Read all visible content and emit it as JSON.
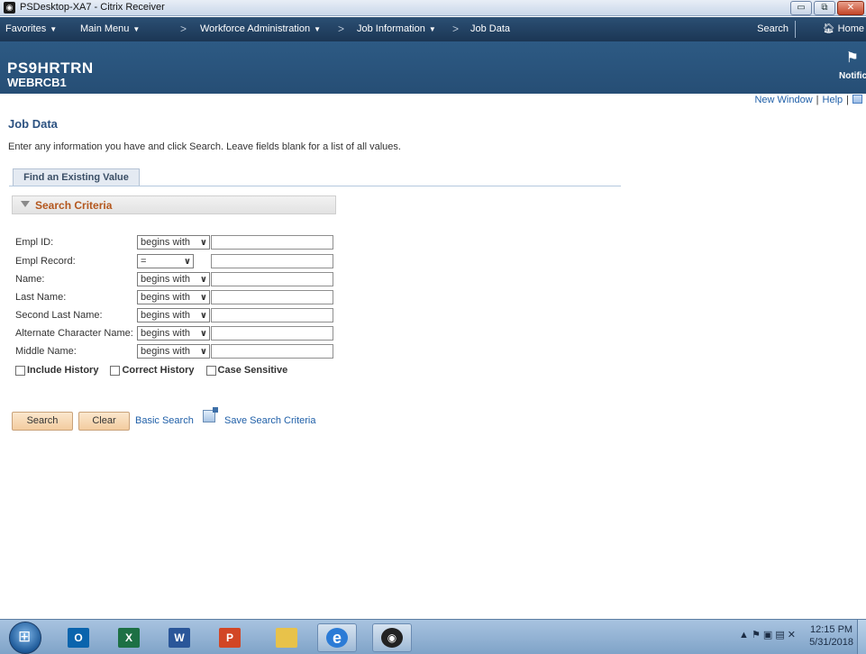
{
  "window": {
    "title": "PSDesktop-XA7 - Citrix Receiver",
    "minimize": "▭",
    "maximize": "⧉",
    "close": "✕"
  },
  "nav": {
    "favorites": "Favorites",
    "main_menu": "Main Menu",
    "breadcrumb_sep": ">",
    "workforce_admin": "Workforce Administration",
    "job_information": "Job Information",
    "job_data": "Job Data",
    "search": "Search",
    "home": "Home"
  },
  "banner": {
    "system": "PS9HRTRN",
    "database": "WEBRCB1",
    "notifications": "Notific"
  },
  "toplinks": {
    "new_window": "New Window",
    "help": "Help"
  },
  "page": {
    "title": "Job Data",
    "instructions": "Enter any information you have and click Search. Leave fields blank for a list of all values.",
    "tab_find": "Find an Existing Value",
    "section_title": "Search Criteria"
  },
  "fields": [
    {
      "label": "Empl ID:",
      "operator": "begins with",
      "value": ""
    },
    {
      "label": "Empl Record:",
      "operator": "=",
      "value": ""
    },
    {
      "label": "Name:",
      "operator": "begins with",
      "value": ""
    },
    {
      "label": "Last Name:",
      "operator": "begins with",
      "value": ""
    },
    {
      "label": "Second Last Name:",
      "operator": "begins with",
      "value": ""
    },
    {
      "label": "Alternate Character Name:",
      "operator": "begins with",
      "value": ""
    },
    {
      "label": "Middle Name:",
      "operator": "begins with",
      "value": ""
    }
  ],
  "checkboxes": {
    "include_history": "Include History",
    "correct_history": "Correct History",
    "case_sensitive": "Case Sensitive"
  },
  "actions": {
    "search": "Search",
    "clear": "Clear",
    "basic_search": "Basic Search",
    "save_search": "Save Search Criteria"
  },
  "taskbar": {
    "apps": [
      {
        "name": "outlook",
        "glyph": "O",
        "color": "#0a64ad"
      },
      {
        "name": "excel",
        "glyph": "X",
        "color": "#1d7044"
      },
      {
        "name": "word",
        "glyph": "W",
        "color": "#2a5699"
      },
      {
        "name": "powerpoint",
        "glyph": "P",
        "color": "#d24625"
      },
      {
        "name": "file-explorer",
        "glyph": "",
        "color": "#e8c24a"
      },
      {
        "name": "internet-explorer",
        "glyph": "e",
        "color": "#2b7bd6"
      },
      {
        "name": "citrix-receiver",
        "glyph": "◉",
        "color": "#222222"
      }
    ],
    "tray_icons": "▲  ⚑  ▣  ▤  ✕",
    "time": "12:15 PM",
    "date": "5/31/2018"
  }
}
